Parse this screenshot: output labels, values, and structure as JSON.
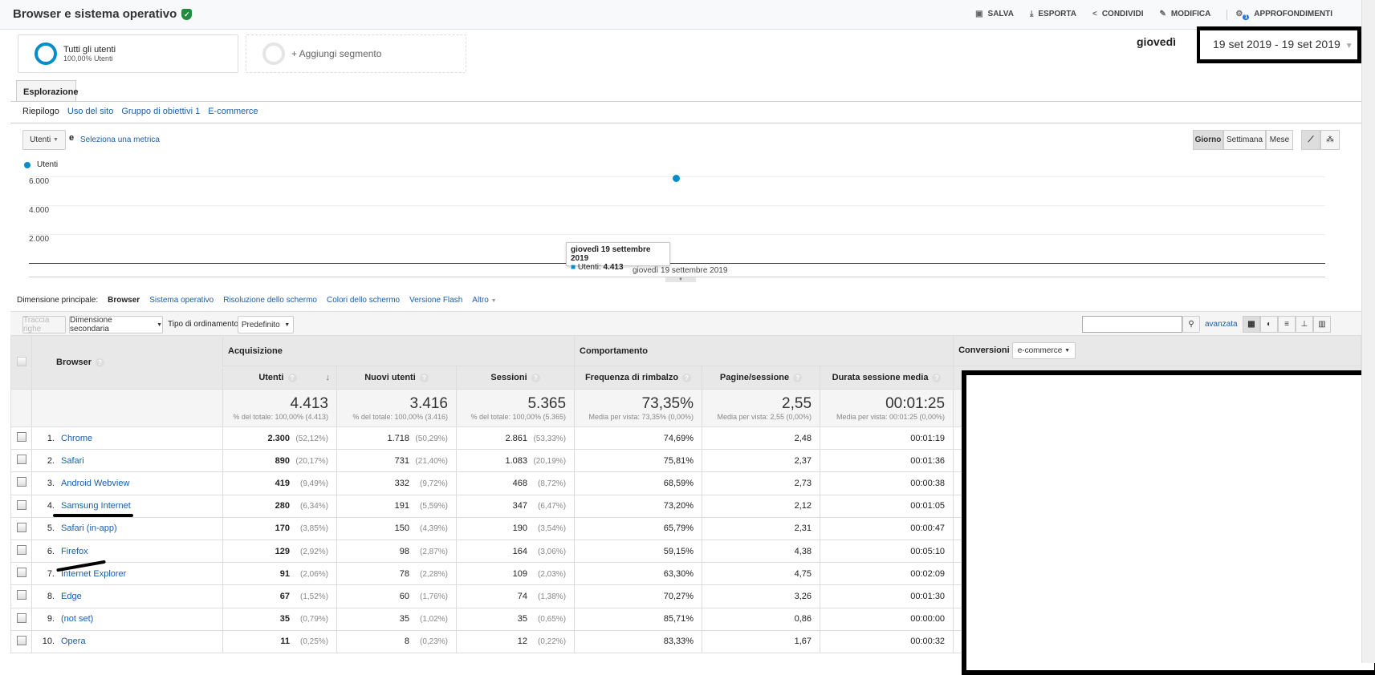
{
  "header": {
    "title": "Browser e sistema operativo",
    "actions": [
      "SALVA",
      "ESPORTA",
      "CONDIVIDI",
      "MODIFICA",
      "APPROFONDIMENTI"
    ],
    "insights_badge": "1"
  },
  "segments": {
    "active_name": "Tutti gli utenti",
    "active_sub": "100,00% Utenti",
    "add": "+ Aggiungi segmento"
  },
  "date": {
    "day": "giovedì",
    "range": "19 set 2019 - 19 set 2019"
  },
  "tabs": [
    "Esplorazione"
  ],
  "subnav": [
    "Riepilogo",
    "Uso del sito",
    "Gruppo di obiettivi 1",
    "E-commerce"
  ],
  "chart_controls": {
    "metric": "Utenti",
    "and": "e",
    "select_metric": "Seleziona una metrica",
    "periods": [
      "Giorno",
      "Settimana",
      "Mese"
    ]
  },
  "chart_data": {
    "type": "line",
    "title": "",
    "series": [
      {
        "name": "Utenti",
        "color": "#058dc7",
        "values": [
          4413
        ]
      }
    ],
    "x": [
      "giovedì 19 settembre 2019"
    ],
    "yticks": [
      "6.000",
      "4.000",
      "2.000"
    ],
    "ylim": [
      0,
      6000
    ],
    "tooltip": {
      "title": "giovedì 19 settembre 2019",
      "label": "Utenti:",
      "value": "4.413"
    }
  },
  "dimension": {
    "label": "Dimensione principale:",
    "current": "Browser",
    "others": [
      "Sistema operativo",
      "Risoluzione dello schermo",
      "Colori dello schermo",
      "Versione Flash",
      "Altro"
    ]
  },
  "toolbar": {
    "plot_rows": "Traccia righe",
    "secondary": "Dimensione secondaria",
    "sort_label": "Tipo di ordinamento:",
    "sort_value": "Predefinito",
    "advanced": "avanzata",
    "search_value": ""
  },
  "table": {
    "groups": {
      "acq": "Acquisizione",
      "beh": "Comportamento",
      "conv": "Conversioni",
      "conv_select": "e-commerce"
    },
    "columns": [
      "Browser",
      "Utenti",
      "Nuovi utenti",
      "Sessioni",
      "Frequenza di rimbalzo",
      "Pagine/sessione",
      "Durata sessione media"
    ],
    "totals": [
      {
        "v": "4.413",
        "s": "% del totale: 100,00% (4.413)"
      },
      {
        "v": "3.416",
        "s": "% del totale: 100,00% (3.416)"
      },
      {
        "v": "5.365",
        "s": "% del totale: 100,00% (5.365)"
      },
      {
        "v": "73,35%",
        "s": "Media per vista: 73,35% (0,00%)"
      },
      {
        "v": "2,55",
        "s": "Media per vista: 2,55 (0,00%)"
      },
      {
        "v": "00:01:25",
        "s": "Media per vista: 00:01:25 (0,00%)"
      }
    ],
    "rows": [
      [
        "1.",
        "Chrome",
        "2.300",
        "(52,12%)",
        "1.718",
        "(50,29%)",
        "2.861",
        "(53,33%)",
        "74,69%",
        "2,48",
        "00:01:19"
      ],
      [
        "2.",
        "Safari",
        "890",
        "(20,17%)",
        "731",
        "(21,40%)",
        "1.083",
        "(20,19%)",
        "75,81%",
        "2,37",
        "00:01:36"
      ],
      [
        "3.",
        "Android Webview",
        "419",
        "(9,49%)",
        "332",
        "(9,72%)",
        "468",
        "(8,72%)",
        "68,59%",
        "2,73",
        "00:00:38"
      ],
      [
        "4.",
        "Samsung Internet",
        "280",
        "(6,34%)",
        "191",
        "(5,59%)",
        "347",
        "(6,47%)",
        "73,20%",
        "2,12",
        "00:01:05"
      ],
      [
        "5.",
        "Safari (in-app)",
        "170",
        "(3,85%)",
        "150",
        "(4,39%)",
        "190",
        "(3,54%)",
        "65,79%",
        "2,31",
        "00:00:47"
      ],
      [
        "6.",
        "Firefox",
        "129",
        "(2,92%)",
        "98",
        "(2,87%)",
        "164",
        "(3,06%)",
        "59,15%",
        "4,38",
        "00:05:10"
      ],
      [
        "7.",
        "Internet Explorer",
        "91",
        "(2,06%)",
        "78",
        "(2,28%)",
        "109",
        "(2,03%)",
        "63,30%",
        "4,75",
        "00:02:09"
      ],
      [
        "8.",
        "Edge",
        "67",
        "(1,52%)",
        "60",
        "(1,76%)",
        "74",
        "(1,38%)",
        "70,27%",
        "3,26",
        "00:01:30"
      ],
      [
        "9.",
        "(not set)",
        "35",
        "(0,79%)",
        "35",
        "(1,02%)",
        "35",
        "(0,65%)",
        "85,71%",
        "0,86",
        "00:00:00"
      ],
      [
        "10.",
        "Opera",
        "11",
        "(0,25%)",
        "8",
        "(0,23%)",
        "12",
        "(0,22%)",
        "83,33%",
        "1,67",
        "00:00:32"
      ]
    ]
  }
}
